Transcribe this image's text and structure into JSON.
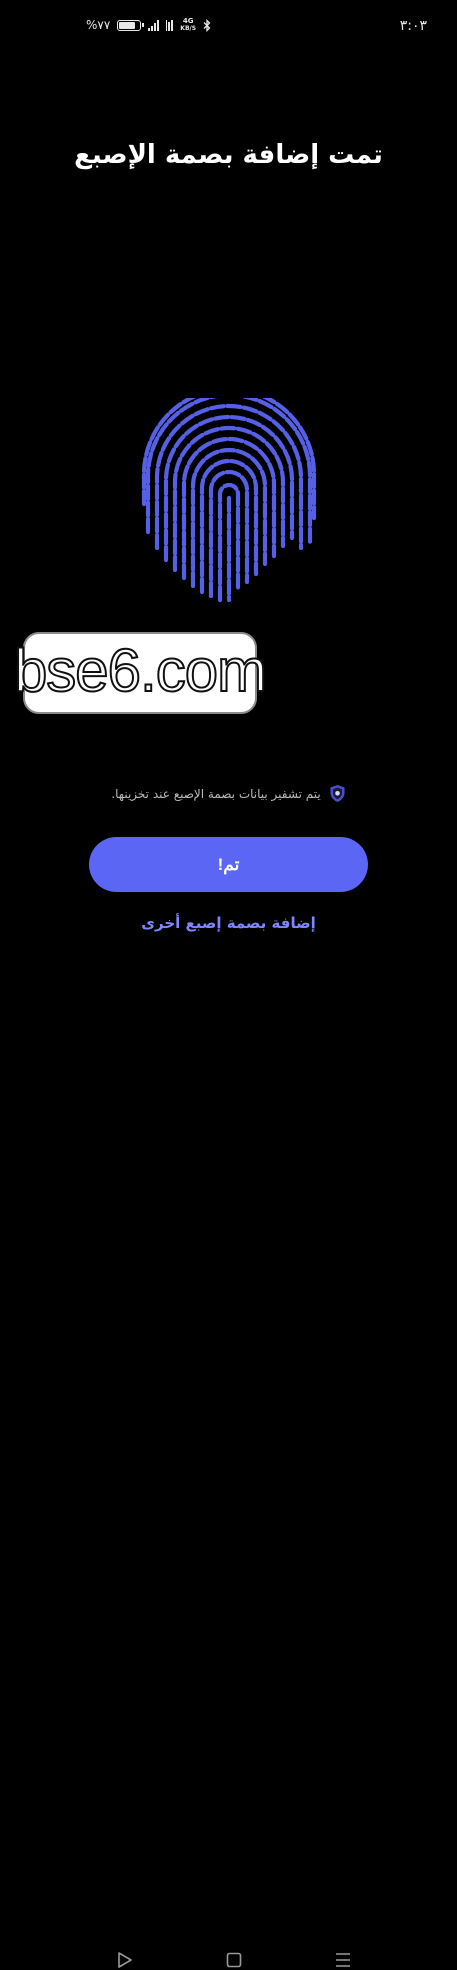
{
  "status_bar": {
    "time": "٣:٠٣",
    "battery_percent": "%٧٧",
    "network_speed_unit": "KB/S",
    "network_type": "4G",
    "icons": [
      "battery-icon",
      "signal-icon",
      "mobile-data-icon",
      "bluetooth-icon"
    ]
  },
  "title": "تمت إضافة بصمة الإصبع",
  "fingerprint": {
    "icon": "fingerprint-icon",
    "color": "#5560e6"
  },
  "watermark": {
    "text": "bse6.com"
  },
  "encryption_note": {
    "text": "يتم تشفير بيانات بصمة الإصبع عند تخزينها.",
    "icon": "shield-icon"
  },
  "done_button": {
    "label": "تم!",
    "color": "#5b66f5"
  },
  "add_another": {
    "label": "إضافة بصمة إصبع أخرى",
    "color": "#7f86ff"
  },
  "nav_bar": {
    "icons": [
      "back-icon",
      "home-icon",
      "menu-icon"
    ]
  }
}
